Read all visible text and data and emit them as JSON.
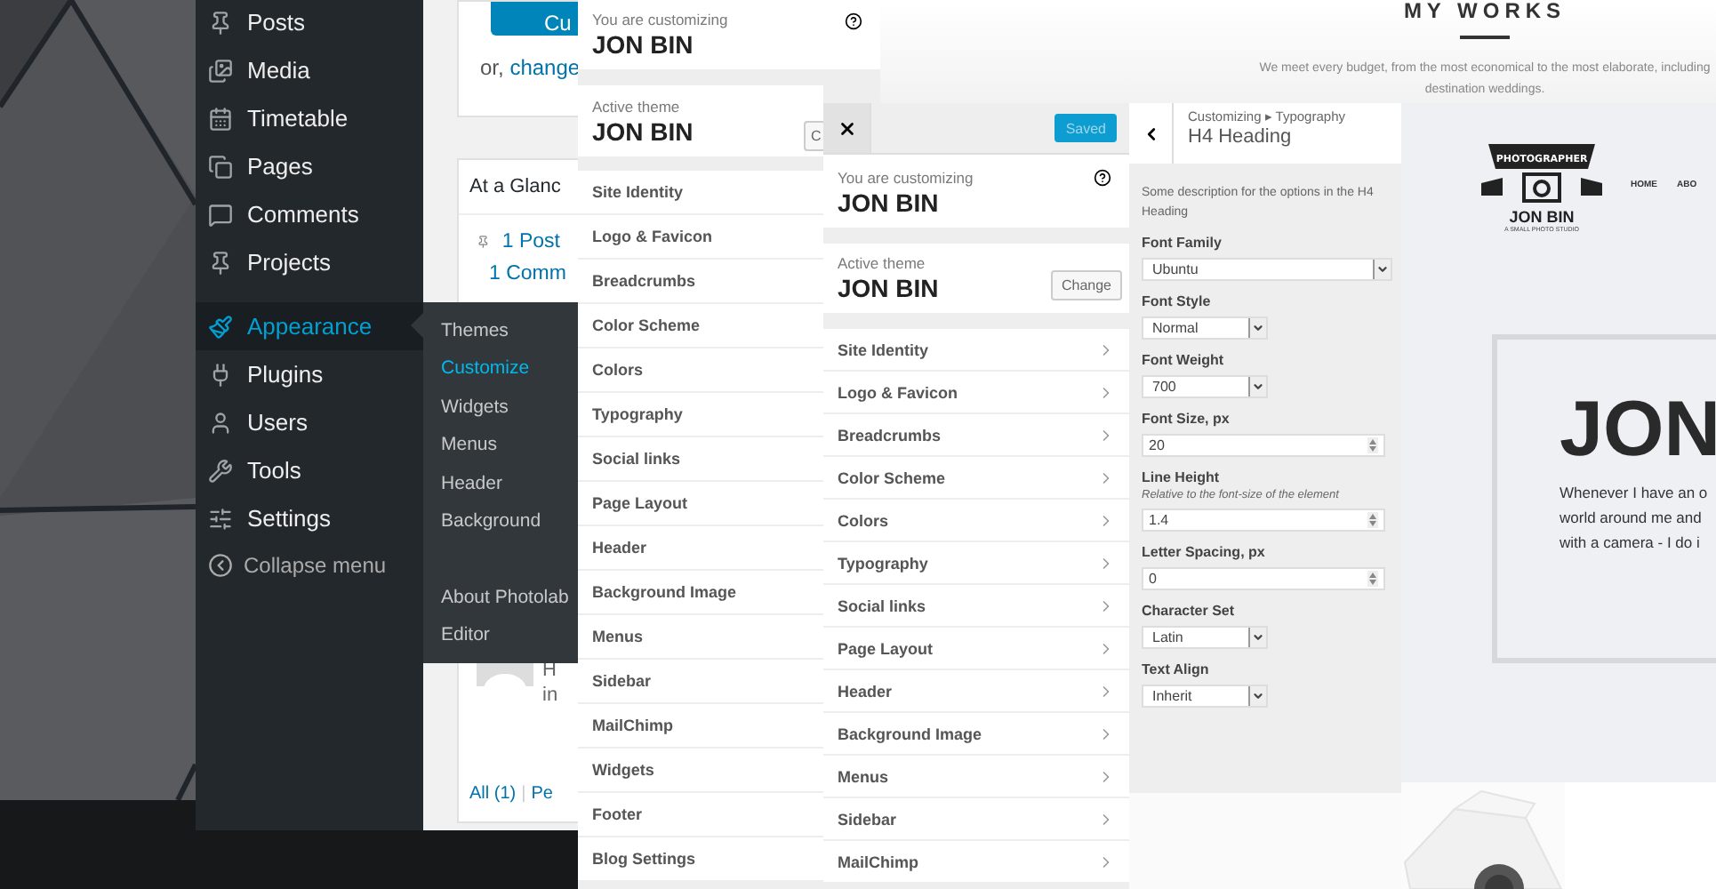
{
  "admin_menu": {
    "groups": [
      [
        {
          "label": "Posts",
          "selected": false
        },
        {
          "label": "Media",
          "selected": false
        },
        {
          "label": "Timetable",
          "selected": false
        },
        {
          "label": "Pages",
          "selected": false
        },
        {
          "label": "Comments",
          "selected": false
        },
        {
          "label": "Projects",
          "selected": false
        }
      ],
      [
        {
          "label": "Appearance",
          "selected": true
        },
        {
          "label": "Plugins",
          "selected": false
        },
        {
          "label": "Users",
          "selected": false
        },
        {
          "label": "Tools",
          "selected": false
        },
        {
          "label": "Settings",
          "selected": false
        }
      ]
    ],
    "collapse": "Collapse menu"
  },
  "submenu": {
    "groups": [
      [
        {
          "label": "Themes",
          "selected": false
        },
        {
          "label": "Customize",
          "selected": true
        },
        {
          "label": "Widgets",
          "selected": false
        },
        {
          "label": "Menus",
          "selected": false
        },
        {
          "label": "Header",
          "selected": false
        },
        {
          "label": "Background",
          "selected": false
        }
      ],
      [
        {
          "label": "About Photolab",
          "selected": false
        },
        {
          "label": "Editor",
          "selected": false
        }
      ]
    ]
  },
  "dashboard": {
    "button": "Cu",
    "change_link": "or, change",
    "glance_title": "At a Glanc",
    "glance_items": [
      "1 Post",
      "1 Comm"
    ],
    "activity_lines": [
      "H",
      "in"
    ],
    "filters": [
      "All (1)",
      "Pe"
    ],
    "filter_separator": "|"
  },
  "customizer_back": {
    "customizing_label": "You are customizing",
    "site_name": "JON BIN",
    "theme_label": "Active theme",
    "theme_name": "JON BIN",
    "change_button": "C",
    "sections": [
      "Site Identity",
      "Logo & Favicon",
      "Breadcrumbs",
      "Color Scheme",
      "Colors",
      "Typography",
      "Social links",
      "Page Layout",
      "Header",
      "Background Image",
      "Menus",
      "Sidebar",
      "MailChimp",
      "Widgets",
      "Footer",
      "Blog Settings"
    ]
  },
  "preview_top": {
    "heading": "MY WORKS",
    "lines": [
      "We meet every budget, from the most economical to the most elaborate, including",
      "destination weddings."
    ]
  },
  "customizer": {
    "save_button": "Saved",
    "customizing_label": "You are customizing",
    "site_name": "JON BIN",
    "theme_label": "Active theme",
    "theme_name": "JON BIN",
    "change_button": "Change",
    "sections": [
      "Site Identity",
      "Logo & Favicon",
      "Breadcrumbs",
      "Color Scheme",
      "Colors",
      "Typography",
      "Social links",
      "Page Layout",
      "Header",
      "Background Image",
      "Menus",
      "Sidebar",
      "MailChimp"
    ]
  },
  "typography_panel": {
    "breadcrumb": "Customizing ▸ Typography",
    "title": "H4 Heading",
    "description": "Some description for the options in the H4 Heading",
    "controls": [
      {
        "kind": "select",
        "label": "Font Family",
        "value": "Ubuntu",
        "wide": true
      },
      {
        "kind": "select",
        "label": "Font Style",
        "value": "Normal",
        "wide": false
      },
      {
        "kind": "select",
        "label": "Font Weight",
        "value": "700",
        "wide": false
      },
      {
        "kind": "number",
        "label": "Font Size, px",
        "value": "20"
      },
      {
        "kind": "number",
        "label": "Line Height",
        "hint": "Relative to the font-size of the element",
        "value": "1.4"
      },
      {
        "kind": "number",
        "label": "Letter Spacing, px",
        "value": "0"
      },
      {
        "kind": "select",
        "label": "Character Set",
        "value": "Latin",
        "wide": false
      },
      {
        "kind": "select",
        "label": "Text Align",
        "value": "Inherit",
        "wide": false
      }
    ]
  },
  "preview": {
    "logo_ribbon": "PHOTOGRAPHER",
    "logo_name": "JON BIN",
    "logo_tagline": "A SMALL PHOTO STUDIO",
    "nav": [
      "HOME",
      "ABO"
    ],
    "hero_title": "JON",
    "hero_lines": [
      "Whenever I have an o",
      "world around me and",
      "with a camera - I do i"
    ]
  }
}
